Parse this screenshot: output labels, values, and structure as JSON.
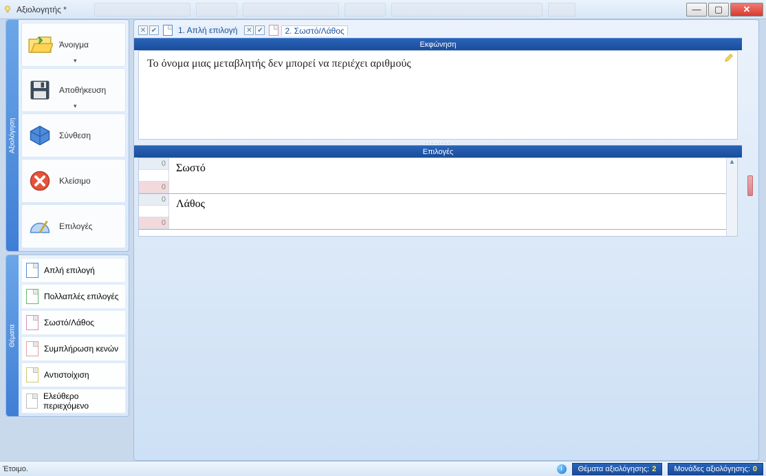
{
  "window": {
    "title": "Αξιολογητής *"
  },
  "sidebar": {
    "panel1_label": "Αξιολόγηση",
    "buttons": {
      "open": "Άνοιγμα",
      "save": "Αποθήκευση",
      "compose": "Σύνθεση",
      "close": "Κλείσιμο",
      "options": "Επιλογές"
    },
    "panel2_label": "Θέματα",
    "types": {
      "single": "Απλή επιλογή",
      "multiple": "Πολλαπλές επιλογές",
      "truefalse": "Σωστό/Λάθος",
      "fillblanks": "Συμπλήρωση κενών",
      "matching": "Αντιστοίχιση",
      "freeform": "Ελεύθερο περιεχόμενο"
    }
  },
  "tabs": [
    {
      "label": "1. Απλή επιλογή"
    },
    {
      "label": "2. Σωστό/Λάθος"
    }
  ],
  "headers": {
    "question": "Εκφώνηση",
    "choices": "Επιλογές"
  },
  "question_text": "Το όνομα μιας μεταβλητής δεν μπορεί να περιέχει αριθμούς",
  "choices": [
    {
      "text": "Σωστό",
      "top_num": "0",
      "bottom_num": "0"
    },
    {
      "text": "Λάθος",
      "top_num": "0",
      "bottom_num": "0"
    }
  ],
  "status": {
    "ready": "Έτοιμο.",
    "topics_label": "Θέματα αξιολόγησης:",
    "topics_count": "2",
    "units_label": "Μονάδες αξιολόγησης:",
    "units_count": "0"
  }
}
